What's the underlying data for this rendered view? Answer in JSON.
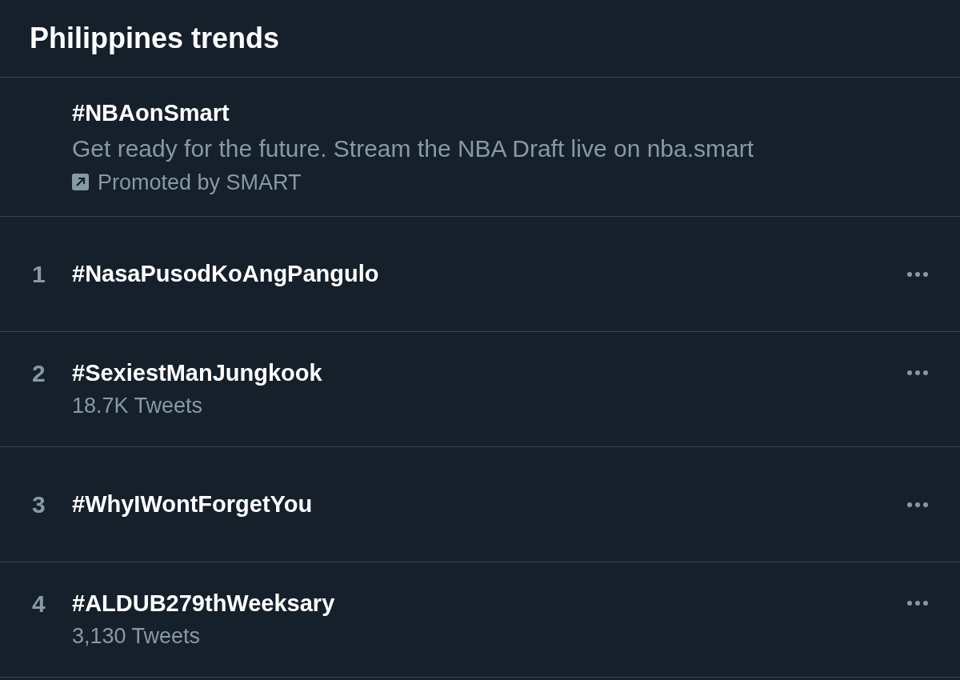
{
  "header": {
    "title": "Philippines trends"
  },
  "promoted": {
    "hashtag": "#NBAonSmart",
    "description": "Get ready for the future. Stream the NBA Draft live on nba.smart",
    "promoted_by": "Promoted by SMART"
  },
  "trends": [
    {
      "rank": "1",
      "hashtag": "#NasaPusodKoAngPangulo"
    },
    {
      "rank": "2",
      "hashtag": "#SexiestManJungkook",
      "tweets": "18.7K Tweets"
    },
    {
      "rank": "3",
      "hashtag": "#WhyIWontForgetYou"
    },
    {
      "rank": "4",
      "hashtag": "#ALDUB279thWeeksary",
      "tweets": "3,130 Tweets"
    }
  ]
}
